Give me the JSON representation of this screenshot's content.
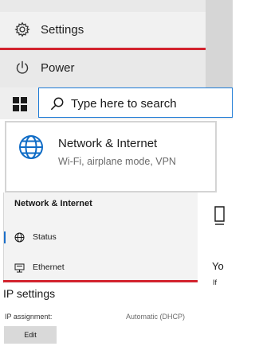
{
  "start_menu": {
    "settings_label": "Settings",
    "settings_icon": "gear-icon",
    "power_label": "Power",
    "power_icon": "power-icon",
    "highlight_color": "#d3242f"
  },
  "taskbar": {
    "start_icon": "windows-logo-icon",
    "search": {
      "icon": "search-icon",
      "placeholder": "Type here to search",
      "value": ""
    },
    "accent_color": "#1c7ad6"
  },
  "category_card": {
    "icon": "globe-icon",
    "title": "Network & Internet",
    "subtitle": "Wi-Fi, airplane mode, VPN"
  },
  "settings_nav": {
    "heading": "Network & Internet",
    "items": [
      {
        "label": "Status",
        "icon": "status-globe-icon",
        "selected": true
      },
      {
        "label": "Ethernet",
        "icon": "ethernet-icon",
        "selected": false
      }
    ],
    "selection_color": "#1c6fc9"
  },
  "main_clipped": {
    "text_y": "Yo",
    "text_if": "If"
  },
  "ip_settings": {
    "title": "IP settings",
    "assignment_label": "IP assignment:",
    "assignment_value": "Automatic (DHCP)",
    "edit_label": "Edit"
  }
}
